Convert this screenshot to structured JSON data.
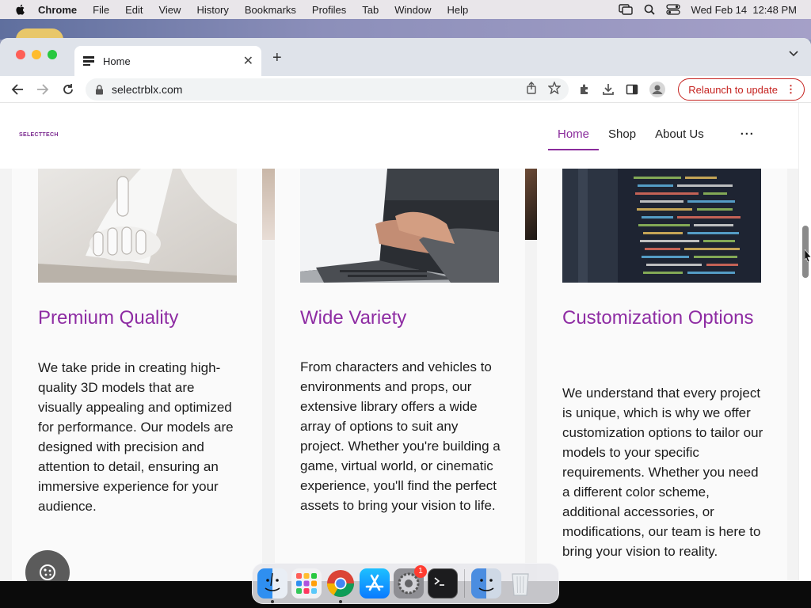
{
  "menubar": {
    "app": "Chrome",
    "items": [
      "File",
      "Edit",
      "View",
      "History",
      "Bookmarks",
      "Profiles",
      "Tab",
      "Window",
      "Help"
    ],
    "datetime": "Wed Feb 14  12:48 PM"
  },
  "browser": {
    "tab_title": "Home",
    "url": "selectrblx.com",
    "relaunch_label": "Relaunch to update"
  },
  "site": {
    "logo": "SELECTTECH",
    "nav": [
      "Home",
      "Shop",
      "About Us"
    ],
    "nav_more": "···",
    "cards": [
      {
        "title": "Premium Quality",
        "body": "We take pride in creating high-quality 3D models that are visually appealing and optimized for performance. Our models are designed with precision and attention to detail, ensuring an immersive experience for your audience."
      },
      {
        "title": "Wide Variety",
        "body": "From characters and vehicles to environments and props, our extensive library offers a wide array of options to suit any project. Whether you're building a game, virtual world, or cinematic experience, you'll find the perfect assets to bring your vision to life."
      },
      {
        "title": "Customization Options",
        "body": "We understand that every project is unique, which is why we offer customization options to tailor our models to your specific requirements. Whether you need a different color scheme, additional accessories, or modifications, our team is here to bring your vision to reality."
      }
    ]
  },
  "dock": {
    "apps": [
      "finder-icon",
      "launchpad-icon",
      "chrome-icon",
      "app-store-icon",
      "system-settings-icon",
      "terminal-icon",
      "finder-alt-icon",
      "trash-icon"
    ],
    "settings_badge": "1"
  }
}
